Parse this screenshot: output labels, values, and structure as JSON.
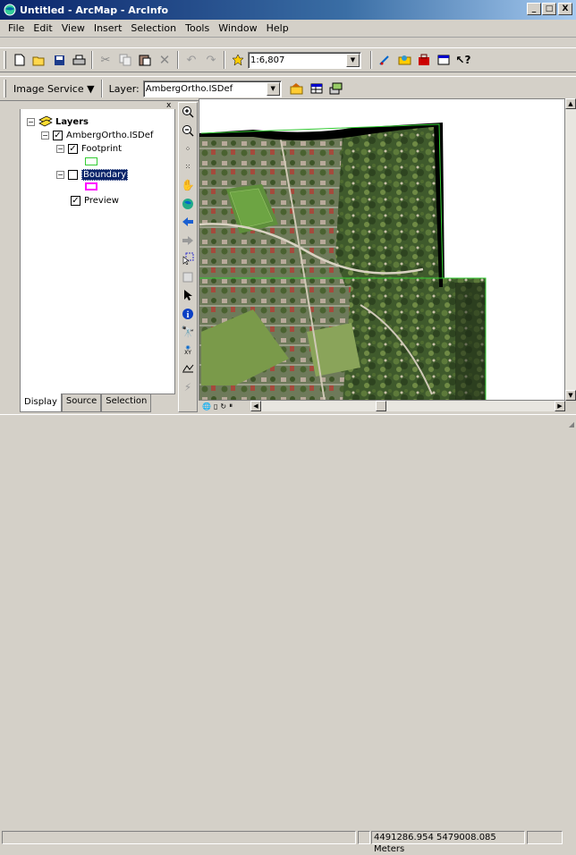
{
  "window": {
    "title": "Untitled - ArcMap - ArcInfo",
    "minimize": "_",
    "maximize": "□",
    "close": "X"
  },
  "menu": [
    "File",
    "Edit",
    "View",
    "Insert",
    "Selection",
    "Tools",
    "Window",
    "Help"
  ],
  "standard_toolbar": {
    "scale_value": "1:6,807"
  },
  "image_toolbar": {
    "image_service_label": "Image Service ▼",
    "layer_label": "Layer:",
    "layer_value": "AmbergOrtho.ISDef"
  },
  "toc": {
    "close": "x",
    "root": "Layers",
    "layer": "AmbergOrtho.ISDef",
    "sublayers": [
      {
        "name": "Footprint",
        "checked": true,
        "symbol_color": "#33cc33"
      },
      {
        "name": "Boundary",
        "checked": false,
        "symbol_color": "#ff00ff",
        "selected": true
      },
      {
        "name": "Preview",
        "checked": true
      }
    ],
    "tabs": [
      "Display",
      "Source",
      "Selection"
    ]
  },
  "status": {
    "coordinates": "4491286.954  5479008.085 Meters"
  },
  "colors": {
    "footprint_line": "#33cc33",
    "boundary": "#ff00ff",
    "selection_bg": "#0a246a"
  }
}
